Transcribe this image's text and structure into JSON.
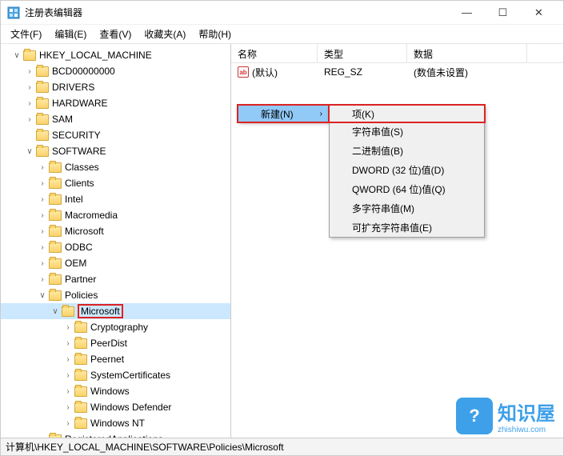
{
  "window": {
    "title": "注册表编辑器"
  },
  "menu": {
    "file": "文件(F)",
    "edit": "编辑(E)",
    "view": "查看(V)",
    "fav": "收藏夹(A)",
    "help": "帮助(H)"
  },
  "tree": {
    "root": "HKEY_LOCAL_MACHINE",
    "n": {
      "bcd": "BCD00000000",
      "drivers": "DRIVERS",
      "hardware": "HARDWARE",
      "sam": "SAM",
      "security": "SECURITY",
      "software": "SOFTWARE",
      "classes": "Classes",
      "clients": "Clients",
      "intel": "Intel",
      "macromedia": "Macromedia",
      "microsoft": "Microsoft",
      "odbc": "ODBC",
      "oem": "OEM",
      "partner": "Partner",
      "policies": "Policies",
      "pol_microsoft": "Microsoft",
      "cryptography": "Cryptography",
      "peerdist": "PeerDist",
      "peernet": "Peernet",
      "syscert": "SystemCertificates",
      "windows": "Windows",
      "windef": "Windows Defender",
      "winnt": "Windows NT",
      "regapps": "RegisteredApplications"
    }
  },
  "list": {
    "hdr": {
      "name": "名称",
      "type": "类型",
      "data": "数据"
    },
    "row": {
      "name": "(默认)",
      "type": "REG_SZ",
      "data": "(数值未设置)"
    }
  },
  "ctx": {
    "new": "新建(N)",
    "sub": {
      "key": "项(K)",
      "string": "字符串值(S)",
      "binary": "二进制值(B)",
      "dword": "DWORD (32 位)值(D)",
      "qword": "QWORD (64 位)值(Q)",
      "multi": "多字符串值(M)",
      "expand": "可扩充字符串值(E)"
    }
  },
  "statusbar": "计算机\\HKEY_LOCAL_MACHINE\\SOFTWARE\\Policies\\Microsoft",
  "watermark": {
    "brand": "知识屋",
    "domain": "zhishiwu.com"
  }
}
